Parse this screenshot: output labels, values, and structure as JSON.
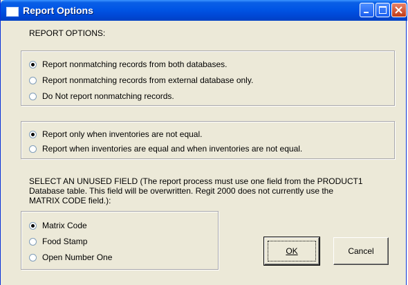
{
  "window": {
    "title": "Report Options"
  },
  "header": {
    "label": "REPORT OPTIONS:"
  },
  "group1": {
    "options": [
      {
        "label": "Report nonmatching records from both databases.",
        "checked": true
      },
      {
        "label": "Report nonmatching records from external database only.",
        "checked": false
      },
      {
        "label": "Do Not report nonmatching records.",
        "checked": false
      }
    ]
  },
  "group2": {
    "options": [
      {
        "label": "Report only when inventories are not equal.",
        "checked": true
      },
      {
        "label": "Report when inventories are equal and when inventories are not equal.",
        "checked": false
      }
    ]
  },
  "unused_field": {
    "instruction_line1": "SELECT AN UNUSED FIELD  (The report process must use one field from the PRODUCT1",
    "instruction_line2": "Database table.  This field will be overwritten.  Regit 2000 does not currently use the",
    "instruction_line3": "MATRIX CODE field.):",
    "options": [
      {
        "label": "Matrix Code",
        "checked": true
      },
      {
        "label": "Food Stamp",
        "checked": false
      },
      {
        "label": "Open Number One",
        "checked": false
      }
    ]
  },
  "buttons": {
    "ok_label": "OK",
    "cancel_label": "Cancel"
  }
}
